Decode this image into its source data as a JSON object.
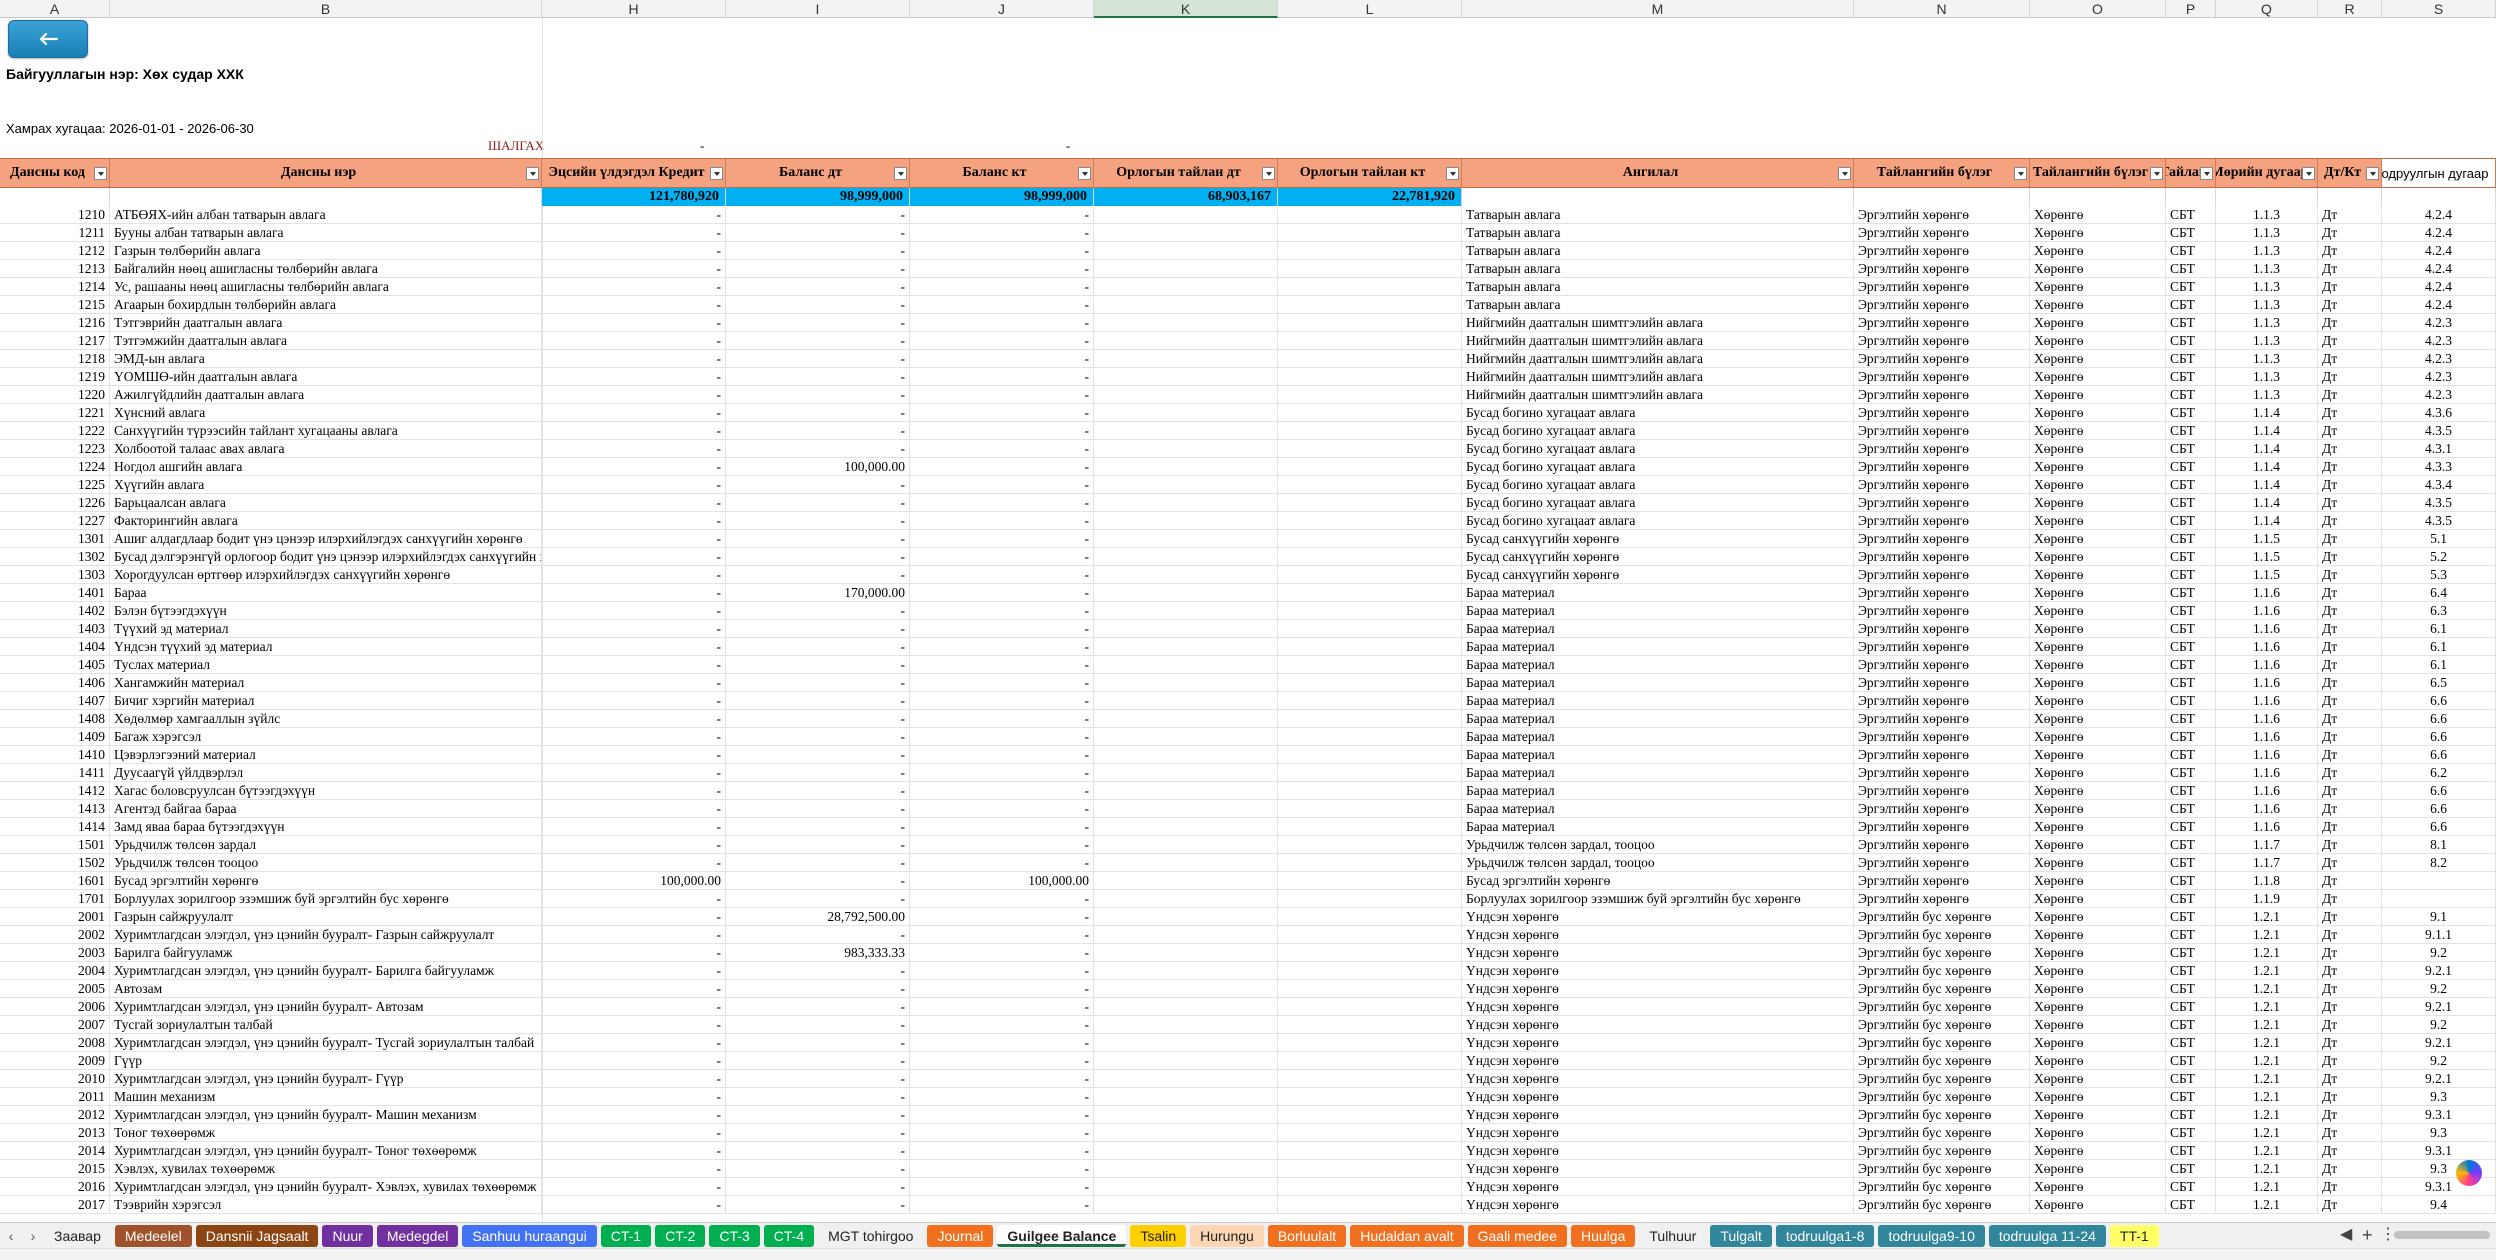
{
  "column_letters": [
    "A",
    "B",
    "H",
    "I",
    "J",
    "K",
    "L",
    "M",
    "N",
    "O",
    "P",
    "Q",
    "R",
    "S"
  ],
  "selected_column": "K",
  "org_name": "Байгууллагын нэр: Хөх судар ХХК",
  "period": "Хамрах хугацаа: 2026-01-01 - 2026-06-30",
  "check_label": "ШАЛГАХ",
  "check_values": [
    "-",
    "-"
  ],
  "headers": [
    "Дансны код",
    "Дансны нэр",
    "Эцсийн үлдэгдэл Кредит",
    "Баланс дт",
    "Баланс кт",
    "Орлогын тайлан дт",
    "Орлогын тайлан кт",
    "Ангилал",
    "Тайлангийн бүлэг",
    "Тайлангийн бүлэг",
    "Тайлан",
    "Мөрийн дугаар",
    "Дт/Кт",
    "Тодруулгын дугаар"
  ],
  "totals": [
    "",
    "",
    "121,780,920",
    "98,999,000",
    "98,999,000",
    "68,903,167",
    "22,781,920"
  ],
  "rows": [
    [
      "1210",
      "АТБӨЯХ-ийн албан татварын авлага",
      "-",
      "-",
      "-",
      "",
      "",
      "Татварын авлага",
      "Эргэлтийн хөрөнгө",
      "Хөрөнгө",
      "СБТ",
      "1.1.3",
      "Дт",
      "4.2.4"
    ],
    [
      "1211",
      "Бууны албан татварын авлага",
      "-",
      "-",
      "-",
      "",
      "",
      "Татварын авлага",
      "Эргэлтийн хөрөнгө",
      "Хөрөнгө",
      "СБТ",
      "1.1.3",
      "Дт",
      "4.2.4"
    ],
    [
      "1212",
      "Газрын төлбөрийн авлага",
      "-",
      "-",
      "-",
      "",
      "",
      "Татварын авлага",
      "Эргэлтийн хөрөнгө",
      "Хөрөнгө",
      "СБТ",
      "1.1.3",
      "Дт",
      "4.2.4"
    ],
    [
      "1213",
      "Байгалийн нөөц ашигласны төлбөрийн авлага",
      "-",
      "-",
      "-",
      "",
      "",
      "Татварын авлага",
      "Эргэлтийн хөрөнгө",
      "Хөрөнгө",
      "СБТ",
      "1.1.3",
      "Дт",
      "4.2.4"
    ],
    [
      "1214",
      "Ус, рашааны нөөц ашигласны төлбөрийн авлага",
      "-",
      "-",
      "-",
      "",
      "",
      "Татварын авлага",
      "Эргэлтийн хөрөнгө",
      "Хөрөнгө",
      "СБТ",
      "1.1.3",
      "Дт",
      "4.2.4"
    ],
    [
      "1215",
      "Агаарын бохирдлын төлбөрийн авлага",
      "-",
      "-",
      "-",
      "",
      "",
      "Татварын авлага",
      "Эргэлтийн хөрөнгө",
      "Хөрөнгө",
      "СБТ",
      "1.1.3",
      "Дт",
      "4.2.4"
    ],
    [
      "1216",
      "Тэтгэврийн даатгалын авлага",
      "-",
      "-",
      "-",
      "",
      "",
      "Нийгмийн даатгалын шимтгэлийн авлага",
      "Эргэлтийн хөрөнгө",
      "Хөрөнгө",
      "СБТ",
      "1.1.3",
      "Дт",
      "4.2.3"
    ],
    [
      "1217",
      "Тэтгэмжийн даатгалын авлага",
      "-",
      "-",
      "-",
      "",
      "",
      "Нийгмийн даатгалын шимтгэлийн авлага",
      "Эргэлтийн хөрөнгө",
      "Хөрөнгө",
      "СБТ",
      "1.1.3",
      "Дт",
      "4.2.3"
    ],
    [
      "1218",
      "ЭМД-ын авлага",
      "-",
      "-",
      "-",
      "",
      "",
      "Нийгмийн даатгалын шимтгэлийн авлага",
      "Эргэлтийн хөрөнгө",
      "Хөрөнгө",
      "СБТ",
      "1.1.3",
      "Дт",
      "4.2.3"
    ],
    [
      "1219",
      "ҮОМШӨ-ийн даатгалын авлага",
      "-",
      "-",
      "-",
      "",
      "",
      "Нийгмийн даатгалын шимтгэлийн авлага",
      "Эргэлтийн хөрөнгө",
      "Хөрөнгө",
      "СБТ",
      "1.1.3",
      "Дт",
      "4.2.3"
    ],
    [
      "1220",
      "Ажилгүйдлийн даатгалын авлага",
      "-",
      "-",
      "-",
      "",
      "",
      "Нийгмийн даатгалын шимтгэлийн авлага",
      "Эргэлтийн хөрөнгө",
      "Хөрөнгө",
      "СБТ",
      "1.1.3",
      "Дт",
      "4.2.3"
    ],
    [
      "1221",
      "Хүнсний авлага",
      "-",
      "-",
      "-",
      "",
      "",
      "Бусад богино хугацаат авлага",
      "Эргэлтийн хөрөнгө",
      "Хөрөнгө",
      "СБТ",
      "1.1.4",
      "Дт",
      "4.3.6"
    ],
    [
      "1222",
      "Санхүүгийн түрээсийн тайлант хугацааны авлага",
      "-",
      "-",
      "-",
      "",
      "",
      "Бусад богино хугацаат авлага",
      "Эргэлтийн хөрөнгө",
      "Хөрөнгө",
      "СБТ",
      "1.1.4",
      "Дт",
      "4.3.5"
    ],
    [
      "1223",
      "Холбоотой талаас авах авлага",
      "-",
      "-",
      "-",
      "",
      "",
      "Бусад богино хугацаат авлага",
      "Эргэлтийн хөрөнгө",
      "Хөрөнгө",
      "СБТ",
      "1.1.4",
      "Дт",
      "4.3.1"
    ],
    [
      "1224",
      "Ногдол ашгийн авлага",
      "-",
      "100,000.00",
      "-",
      "",
      "",
      "Бусад богино хугацаат авлага",
      "Эргэлтийн хөрөнгө",
      "Хөрөнгө",
      "СБТ",
      "1.1.4",
      "Дт",
      "4.3.3"
    ],
    [
      "1225",
      "Хүүгийн авлага",
      "-",
      "-",
      "-",
      "",
      "",
      "Бусад богино хугацаат авлага",
      "Эргэлтийн хөрөнгө",
      "Хөрөнгө",
      "СБТ",
      "1.1.4",
      "Дт",
      "4.3.4"
    ],
    [
      "1226",
      "Барьцаалсан авлага",
      "-",
      "-",
      "-",
      "",
      "",
      "Бусад богино хугацаат авлага",
      "Эргэлтийн хөрөнгө",
      "Хөрөнгө",
      "СБТ",
      "1.1.4",
      "Дт",
      "4.3.5"
    ],
    [
      "1227",
      "Факторингийн авлага",
      "-",
      "-",
      "-",
      "",
      "",
      "Бусад богино хугацаат авлага",
      "Эргэлтийн хөрөнгө",
      "Хөрөнгө",
      "СБТ",
      "1.1.4",
      "Дт",
      "4.3.5"
    ],
    [
      "1301",
      "Ашиг алдагдлаар бодит үнэ цэнээр илэрхийлэгдэх санхүүгийн хөрөнгө",
      "-",
      "-",
      "-",
      "",
      "",
      "Бусад санхүүгийн хөрөнгө",
      "Эргэлтийн хөрөнгө",
      "Хөрөнгө",
      "СБТ",
      "1.1.5",
      "Дт",
      "5.1"
    ],
    [
      "1302",
      "Бусад дэлгэрэнгүй орлогоор бодит үнэ цэнээр илэрхийлэгдэх санхүүгийн хөрөнгө",
      "-",
      "-",
      "-",
      "",
      "",
      "Бусад санхүүгийн хөрөнгө",
      "Эргэлтийн хөрөнгө",
      "Хөрөнгө",
      "СБТ",
      "1.1.5",
      "Дт",
      "5.2"
    ],
    [
      "1303",
      "Хорогдуулсан өртгөөр илэрхийлэгдэх санхүүгийн хөрөнгө",
      "-",
      "-",
      "-",
      "",
      "",
      "Бусад санхүүгийн хөрөнгө",
      "Эргэлтийн хөрөнгө",
      "Хөрөнгө",
      "СБТ",
      "1.1.5",
      "Дт",
      "5.3"
    ],
    [
      "1401",
      "Бараа",
      "-",
      "170,000.00",
      "-",
      "",
      "",
      "Бараа материал",
      "Эргэлтийн хөрөнгө",
      "Хөрөнгө",
      "СБТ",
      "1.1.6",
      "Дт",
      "6.4"
    ],
    [
      "1402",
      "Бэлэн бүтээгдэхүүн",
      "-",
      "-",
      "-",
      "",
      "",
      "Бараа материал",
      "Эргэлтийн хөрөнгө",
      "Хөрөнгө",
      "СБТ",
      "1.1.6",
      "Дт",
      "6.3"
    ],
    [
      "1403",
      "Түүхий эд материал",
      "-",
      "-",
      "-",
      "",
      "",
      "Бараа материал",
      "Эргэлтийн хөрөнгө",
      "Хөрөнгө",
      "СБТ",
      "1.1.6",
      "Дт",
      "6.1"
    ],
    [
      "1404",
      "Үндсэн түүхий эд материал",
      "-",
      "-",
      "-",
      "",
      "",
      "Бараа материал",
      "Эргэлтийн хөрөнгө",
      "Хөрөнгө",
      "СБТ",
      "1.1.6",
      "Дт",
      "6.1"
    ],
    [
      "1405",
      "Туслах материал",
      "-",
      "-",
      "-",
      "",
      "",
      "Бараа материал",
      "Эргэлтийн хөрөнгө",
      "Хөрөнгө",
      "СБТ",
      "1.1.6",
      "Дт",
      "6.1"
    ],
    [
      "1406",
      "Хангамжийн материал",
      "-",
      "-",
      "-",
      "",
      "",
      "Бараа материал",
      "Эргэлтийн хөрөнгө",
      "Хөрөнгө",
      "СБТ",
      "1.1.6",
      "Дт",
      "6.5"
    ],
    [
      "1407",
      "Бичиг хэргийн материал",
      "-",
      "-",
      "-",
      "",
      "",
      "Бараа материал",
      "Эргэлтийн хөрөнгө",
      "Хөрөнгө",
      "СБТ",
      "1.1.6",
      "Дт",
      "6.6"
    ],
    [
      "1408",
      "Хөдөлмөр хамгааллын зүйлс",
      "-",
      "-",
      "-",
      "",
      "",
      "Бараа материал",
      "Эргэлтийн хөрөнгө",
      "Хөрөнгө",
      "СБТ",
      "1.1.6",
      "Дт",
      "6.6"
    ],
    [
      "1409",
      "Багаж хэрэгсэл",
      "-",
      "-",
      "-",
      "",
      "",
      "Бараа материал",
      "Эргэлтийн хөрөнгө",
      "Хөрөнгө",
      "СБТ",
      "1.1.6",
      "Дт",
      "6.6"
    ],
    [
      "1410",
      "Цэвэрлэгээний материал",
      "-",
      "-",
      "-",
      "",
      "",
      "Бараа материал",
      "Эргэлтийн хөрөнгө",
      "Хөрөнгө",
      "СБТ",
      "1.1.6",
      "Дт",
      "6.6"
    ],
    [
      "1411",
      "Дуусаагүй үйлдвэрлэл",
      "-",
      "-",
      "-",
      "",
      "",
      "Бараа материал",
      "Эргэлтийн хөрөнгө",
      "Хөрөнгө",
      "СБТ",
      "1.1.6",
      "Дт",
      "6.2"
    ],
    [
      "1412",
      "Хагас боловсруулсан бүтээгдэхүүн",
      "-",
      "-",
      "-",
      "",
      "",
      "Бараа материал",
      "Эргэлтийн хөрөнгө",
      "Хөрөнгө",
      "СБТ",
      "1.1.6",
      "Дт",
      "6.6"
    ],
    [
      "1413",
      "Агентэд байгаа бараа",
      "-",
      "-",
      "-",
      "",
      "",
      "Бараа материал",
      "Эргэлтийн хөрөнгө",
      "Хөрөнгө",
      "СБТ",
      "1.1.6",
      "Дт",
      "6.6"
    ],
    [
      "1414",
      "Замд яваа бараа бүтээгдэхүүн",
      "-",
      "-",
      "-",
      "",
      "",
      "Бараа материал",
      "Эргэлтийн хөрөнгө",
      "Хөрөнгө",
      "СБТ",
      "1.1.6",
      "Дт",
      "6.6"
    ],
    [
      "1501",
      "Урьдчилж төлсөн зардал",
      "-",
      "-",
      "-",
      "",
      "",
      "Урьдчилж төлсөн зардал, тооцоо",
      "Эргэлтийн хөрөнгө",
      "Хөрөнгө",
      "СБТ",
      "1.1.7",
      "Дт",
      "8.1"
    ],
    [
      "1502",
      "Урьдчилж төлсөн тооцоо",
      "-",
      "-",
      "-",
      "",
      "",
      "Урьдчилж төлсөн зардал, тооцоо",
      "Эргэлтийн хөрөнгө",
      "Хөрөнгө",
      "СБТ",
      "1.1.7",
      "Дт",
      "8.2"
    ],
    [
      "1601",
      "Бусад эргэлтийн хөрөнгө",
      "100,000.00",
      "-",
      "100,000.00",
      "",
      "",
      "Бусад эргэлтийн хөрөнгө",
      "Эргэлтийн хөрөнгө",
      "Хөрөнгө",
      "СБТ",
      "1.1.8",
      "Дт",
      ""
    ],
    [
      "1701",
      "Борлуулах зорилгоор эзэмшиж буй эргэлтийн бус хөрөнгө",
      "-",
      "-",
      "-",
      "",
      "",
      "Борлуулах зорилгоор эзэмшиж буй эргэлтийн бус хөрөнгө",
      "Эргэлтийн хөрөнгө",
      "Хөрөнгө",
      "СБТ",
      "1.1.9",
      "Дт",
      ""
    ],
    [
      "2001",
      "Газрын сайжруулалт",
      "-",
      "28,792,500.00",
      "-",
      "",
      "",
      "Үндсэн хөрөнгө",
      "Эргэлтийн бус хөрөнгө",
      "Хөрөнгө",
      "СБТ",
      "1.2.1",
      "Дт",
      "9.1"
    ],
    [
      "2002",
      "Хуримтлагдсан элэгдэл, үнэ цэнийн бууралт- Газрын сайжруулалт",
      "-",
      "-",
      "-",
      "",
      "",
      "Үндсэн хөрөнгө",
      "Эргэлтийн бус хөрөнгө",
      "Хөрөнгө",
      "СБТ",
      "1.2.1",
      "Дт",
      "9.1.1"
    ],
    [
      "2003",
      "Барилга байгууламж",
      "-",
      "983,333.33",
      "-",
      "",
      "",
      "Үндсэн хөрөнгө",
      "Эргэлтийн бус хөрөнгө",
      "Хөрөнгө",
      "СБТ",
      "1.2.1",
      "Дт",
      "9.2"
    ],
    [
      "2004",
      "Хуримтлагдсан элэгдэл, үнэ цэнийн бууралт- Барилга байгууламж",
      "-",
      "-",
      "-",
      "",
      "",
      "Үндсэн хөрөнгө",
      "Эргэлтийн бус хөрөнгө",
      "Хөрөнгө",
      "СБТ",
      "1.2.1",
      "Дт",
      "9.2.1"
    ],
    [
      "2005",
      "Автозам",
      "-",
      "-",
      "-",
      "",
      "",
      "Үндсэн хөрөнгө",
      "Эргэлтийн бус хөрөнгө",
      "Хөрөнгө",
      "СБТ",
      "1.2.1",
      "Дт",
      "9.2"
    ],
    [
      "2006",
      "Хуримтлагдсан элэгдэл, үнэ цэнийн бууралт- Автозам",
      "-",
      "-",
      "-",
      "",
      "",
      "Үндсэн хөрөнгө",
      "Эргэлтийн бус хөрөнгө",
      "Хөрөнгө",
      "СБТ",
      "1.2.1",
      "Дт",
      "9.2.1"
    ],
    [
      "2007",
      "Тусгай зориулалтын талбай",
      "-",
      "-",
      "-",
      "",
      "",
      "Үндсэн хөрөнгө",
      "Эргэлтийн бус хөрөнгө",
      "Хөрөнгө",
      "СБТ",
      "1.2.1",
      "Дт",
      "9.2"
    ],
    [
      "2008",
      "Хуримтлагдсан элэгдэл, үнэ цэнийн бууралт- Тусгай зориулалтын талбай",
      "-",
      "-",
      "-",
      "",
      "",
      "Үндсэн хөрөнгө",
      "Эргэлтийн бус хөрөнгө",
      "Хөрөнгө",
      "СБТ",
      "1.2.1",
      "Дт",
      "9.2.1"
    ],
    [
      "2009",
      "Гүүр",
      "-",
      "-",
      "-",
      "",
      "",
      "Үндсэн хөрөнгө",
      "Эргэлтийн бус хөрөнгө",
      "Хөрөнгө",
      "СБТ",
      "1.2.1",
      "Дт",
      "9.2"
    ],
    [
      "2010",
      "Хуримтлагдсан элэгдэл, үнэ цэнийн бууралт- Гүүр",
      "-",
      "-",
      "-",
      "",
      "",
      "Үндсэн хөрөнгө",
      "Эргэлтийн бус хөрөнгө",
      "Хөрөнгө",
      "СБТ",
      "1.2.1",
      "Дт",
      "9.2.1"
    ],
    [
      "2011",
      "Машин механизм",
      "-",
      "-",
      "-",
      "",
      "",
      "Үндсэн хөрөнгө",
      "Эргэлтийн бус хөрөнгө",
      "Хөрөнгө",
      "СБТ",
      "1.2.1",
      "Дт",
      "9.3"
    ],
    [
      "2012",
      "Хуримтлагдсан элэгдэл, үнэ цэнийн бууралт- Машин механизм",
      "-",
      "-",
      "-",
      "",
      "",
      "Үндсэн хөрөнгө",
      "Эргэлтийн бус хөрөнгө",
      "Хөрөнгө",
      "СБТ",
      "1.2.1",
      "Дт",
      "9.3.1"
    ],
    [
      "2013",
      "Тоног төхөөрөмж",
      "-",
      "-",
      "-",
      "",
      "",
      "Үндсэн хөрөнгө",
      "Эргэлтийн бус хөрөнгө",
      "Хөрөнгө",
      "СБТ",
      "1.2.1",
      "Дт",
      "9.3"
    ],
    [
      "2014",
      "Хуримтлагдсан элэгдэл, үнэ цэнийн бууралт- Тоног төхөөрөмж",
      "-",
      "-",
      "-",
      "",
      "",
      "Үндсэн хөрөнгө",
      "Эргэлтийн бус хөрөнгө",
      "Хөрөнгө",
      "СБТ",
      "1.2.1",
      "Дт",
      "9.3.1"
    ],
    [
      "2015",
      "Хэвлэх, хувилах төхөөрөмж",
      "-",
      "-",
      "-",
      "",
      "",
      "Үндсэн хөрөнгө",
      "Эргэлтийн бус хөрөнгө",
      "Хөрөнгө",
      "СБТ",
      "1.2.1",
      "Дт",
      "9.3"
    ],
    [
      "2016",
      "Хуримтлагдсан элэгдэл, үнэ цэнийн бууралт- Хэвлэх, хувилах төхөөрөмж",
      "-",
      "-",
      "-",
      "",
      "",
      "Үндсэн хөрөнгө",
      "Эргэлтийн бус хөрөнгө",
      "Хөрөнгө",
      "СБТ",
      "1.2.1",
      "Дт",
      "9.3.1"
    ],
    [
      "2017",
      "Тээврийн хэрэгсэл",
      "-",
      "-",
      "-",
      "",
      "",
      "Үндсэн хөрөнгө",
      "Эргэлтийн бус хөрөнгө",
      "Хөрөнгө",
      "СБТ",
      "1.2.1",
      "Дт",
      "9.4"
    ]
  ],
  "tabs": [
    {
      "label": "Заавар",
      "color": ""
    },
    {
      "label": "Medeelel",
      "color": "#a0522d"
    },
    {
      "label": "Dansnii Jagsaalt",
      "color": "#8b4513"
    },
    {
      "label": "Nuur",
      "color": "#7030a0"
    },
    {
      "label": "Medegdel",
      "color": "#7030a0"
    },
    {
      "label": "Sanhuu huraangui",
      "color": "#4472f4"
    },
    {
      "label": "CT-1",
      "color": "#00b050"
    },
    {
      "label": "CT-2",
      "color": "#00b050"
    },
    {
      "label": "CT-3",
      "color": "#00b050"
    },
    {
      "label": "CT-4",
      "color": "#00b050"
    },
    {
      "label": "MGT tohirgoo",
      "color": ""
    },
    {
      "label": "Journal",
      "color": "#f07020"
    },
    {
      "label": "Guilgee Balance",
      "color": "active"
    },
    {
      "label": "Tsalin",
      "color": "#ffd000"
    },
    {
      "label": "Hurungu",
      "color": "#fcd5b4"
    },
    {
      "label": "Borluulalt",
      "color": "#f07020"
    },
    {
      "label": "Hudaldan avalt",
      "color": "#f07020"
    },
    {
      "label": "Gaali medee",
      "color": "#f07020"
    },
    {
      "label": "Huulga",
      "color": "#f07020"
    },
    {
      "label": "Tulhuur",
      "color": ""
    },
    {
      "label": "Tulgalt",
      "color": "#31869b"
    },
    {
      "label": "todruulga1-8",
      "color": "#31869b"
    },
    {
      "label": "todruulga9-10",
      "color": "#31869b"
    },
    {
      "label": "todruulga 11-24",
      "color": "#31869b"
    },
    {
      "label": "TT-1",
      "color": "#ffff66"
    }
  ],
  "icons": {
    "back": "arrow-left-icon",
    "filter": "filter-dropdown-icon"
  }
}
